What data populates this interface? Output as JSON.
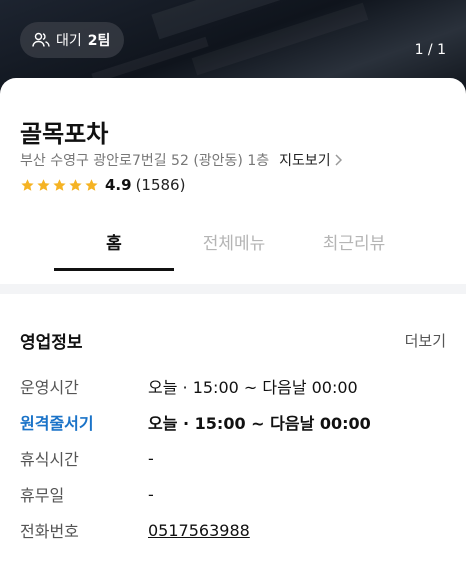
{
  "hero": {
    "wait_label": "대기",
    "wait_count": "2팀",
    "photo_counter": "1 / 1"
  },
  "store": {
    "name": "골목포차",
    "address": "부산 수영구 광안로7번길 52 (광안동) 1층",
    "map_link": "지도보기",
    "rating": "4.9",
    "review_count": "(1586)",
    "star_color": "#f5b323"
  },
  "tabs": {
    "home": "홈",
    "menu": "전체메뉴",
    "reviews": "최근리뷰"
  },
  "business_info": {
    "title": "영업정보",
    "more": "더보기",
    "rows": [
      {
        "key": "운영시간",
        "value": "오늘 · 15:00 ~ 다음날 00:00"
      },
      {
        "key": "원격줄서기",
        "value": "오늘 · 15:00 ~ 다음날 00:00"
      },
      {
        "key": "휴식시간",
        "value": "-"
      },
      {
        "key": "휴무일",
        "value": "-"
      },
      {
        "key": "전화번호",
        "value": "0517563988"
      }
    ],
    "accent_color": "#1a73c8"
  }
}
